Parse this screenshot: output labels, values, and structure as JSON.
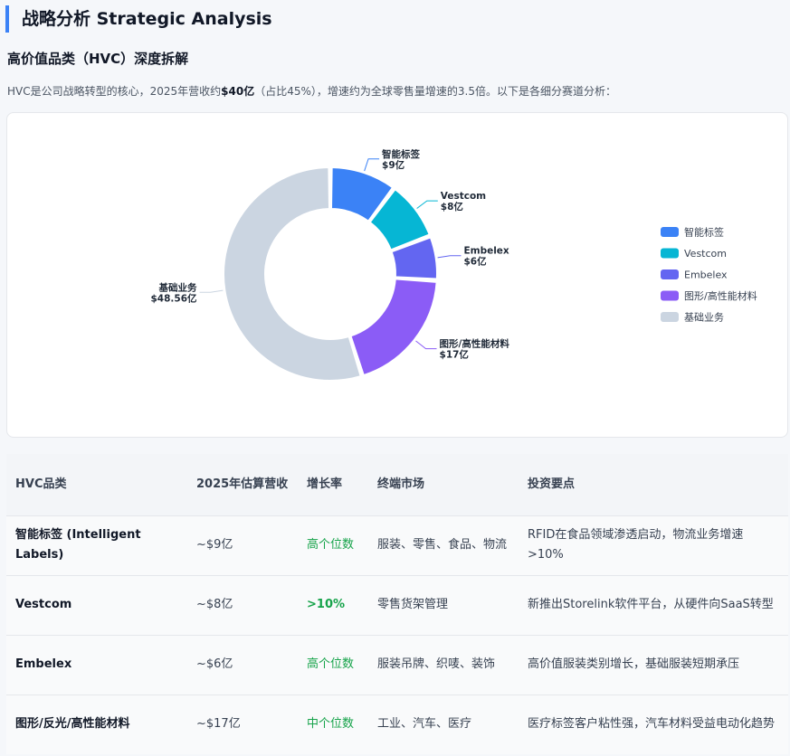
{
  "header": {
    "title": "战略分析 Strategic Analysis",
    "section_title": "高价值品类（HVC）深度拆解",
    "intro_prefix": "HVC是公司战略转型的核心，2025年营收约",
    "intro_bold": "$40亿",
    "intro_suffix": "（占比45%），增速约为全球零售量增速的3.5倍。以下是各细分赛道分析："
  },
  "chart_data": {
    "type": "pie",
    "variant": "donut",
    "title": "",
    "legend_position": "right",
    "categories": [
      "智能标签",
      "Vestcom",
      "Embelex",
      "图形/高性能材料",
      "基础业务"
    ],
    "values": [
      9,
      8,
      6,
      17,
      48.56
    ],
    "value_labels": [
      "$9亿",
      "$8亿",
      "$6亿",
      "$17亿",
      "$48.56亿"
    ],
    "colors": [
      "#3b82f6",
      "#06b6d4",
      "#6366f1",
      "#8b5cf6",
      "#cbd5e1"
    ]
  },
  "table": {
    "headers": [
      "HVC品类",
      "2025年估算营收",
      "增长率",
      "终端市场",
      "投资要点"
    ],
    "rows": [
      {
        "name": "智能标签 (Intelligent Labels)",
        "revenue": "~$9亿",
        "growth": "高个位数",
        "strong": false,
        "market": "服装、零售、食品、物流",
        "point": "RFID在食品领域渗透启动，物流业务增速>10%"
      },
      {
        "name": "Vestcom",
        "revenue": "~$8亿",
        "growth": ">10%",
        "strong": true,
        "market": "零售货架管理",
        "point": "新推出Storelink软件平台，从硬件向SaaS转型"
      },
      {
        "name": "Embelex",
        "revenue": "~$6亿",
        "growth": "高个位数",
        "strong": false,
        "market": "服装吊牌、织唛、装饰",
        "point": "高价值服装类别增长，基础服装短期承压"
      },
      {
        "name": "图形/反光/高性能材料",
        "revenue": "~$17亿",
        "growth": "中个位数",
        "strong": false,
        "market": "工业、汽车、医疗",
        "point": "医疗标签客户粘性强，汽车材料受益电动化趋势"
      }
    ]
  }
}
